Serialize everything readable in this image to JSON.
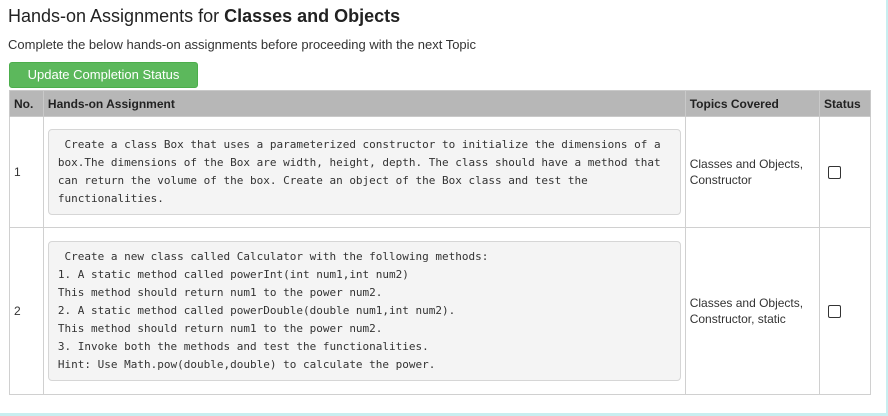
{
  "header": {
    "title_prefix": "Hands-on Assignments for ",
    "title_bold": "Classes and Objects",
    "subtitle": "Complete the below hands-on assignments before proceeding with the next Topic"
  },
  "toolbar": {
    "update_label": "Update Completion Status"
  },
  "table": {
    "headers": {
      "no": "No.",
      "assignment": "Hands-on Assignment",
      "topics": "Topics Covered",
      "status": "Status"
    },
    "rows": [
      {
        "no": "1",
        "assignment": " Create a class Box that uses a parameterized constructor to initialize the dimensions of a box.The dimensions of the Box are width, height, depth. The class should have a method that can return the volume of the box. Create an object of the Box class and test the functionalities.",
        "topics": "Classes and Objects, Constructor",
        "status_checked": false
      },
      {
        "no": "2",
        "assignment": " Create a new class called Calculator with the following methods:\n1. A static method called powerInt(int num1,int num2)\nThis method should return num1 to the power num2.\n2. A static method called powerDouble(double num1,int num2).\nThis method should return num1 to the power num2.\n3. Invoke both the methods and test the functionalities.\nHint: Use Math.pow(double,double) to calculate the power.",
        "topics": "Classes and Objects, Constructor, static",
        "status_checked": false
      }
    ]
  },
  "colors": {
    "button_green": "#5cb85c",
    "header_gray": "#b7b7b7"
  }
}
